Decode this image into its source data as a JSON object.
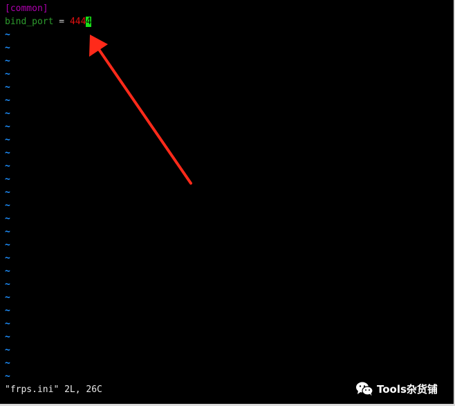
{
  "editor": {
    "lines": [
      {
        "section": "[common]"
      },
      {
        "key": "bind_port",
        "eq": " = ",
        "value": "444",
        "cursor_char": "4"
      }
    ],
    "empty_line_marker": "~",
    "empty_line_count": 27,
    "status": "\"frps.ini\" 2L, 26C"
  },
  "watermark": {
    "icon": "wechat-icon",
    "text": "Tools杂货铺"
  },
  "annotation": {
    "icon": "red-arrow-icon",
    "color": "#ff2a1a"
  }
}
